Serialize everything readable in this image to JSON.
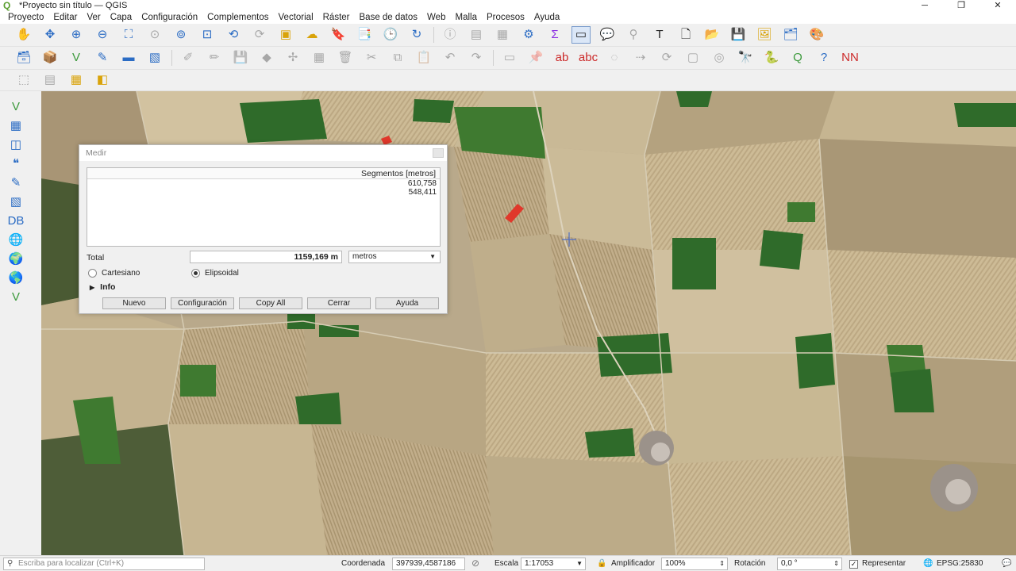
{
  "window": {
    "title": "*Proyecto sin título — QGIS",
    "controls": {
      "minimize": "─",
      "maximize": "❐",
      "close": "✕"
    }
  },
  "menubar": {
    "items": [
      "Proyecto",
      "Editar",
      "Ver",
      "Capa",
      "Configuración",
      "Complementos",
      "Vectorial",
      "Ráster",
      "Base de datos",
      "Web",
      "Malla",
      "Procesos",
      "Ayuda"
    ]
  },
  "colors": {
    "map_base": "#b9a98b",
    "field_green": "#2f6b2a",
    "measure_line": "#e0382b"
  },
  "icons": {
    "app": "qgis-logo-icon",
    "pan": "hand-icon",
    "zoom_in": "zoom-in-icon",
    "zoom_out": "zoom-out-icon",
    "identify": "identify-icon",
    "measure": "ruler-icon",
    "python": "python-icon",
    "help": "help-icon"
  },
  "measure_dialog": {
    "title": "Medir",
    "column_header": "Segmentos [metros]",
    "segments": [
      "610,758",
      "548,411"
    ],
    "total_label": "Total",
    "total_value": "1159,169 m",
    "units": "metros",
    "radio_cartesian": "Cartesiano",
    "radio_ellipsoidal": "Elipsoidal",
    "selected_mode": "Elipsoidal",
    "info_label": "Info",
    "buttons": {
      "new": "Nuevo",
      "config": "Configuración",
      "copy": "Copy All",
      "close": "Cerrar",
      "help": "Ayuda"
    }
  },
  "statusbar": {
    "locator_placeholder": "Escriba para localizar (Ctrl+K)",
    "coord_label": "Coordenada",
    "coord_value": "397939,4587186",
    "scale_label": "Escala",
    "scale_value": "1:17053",
    "magnifier_label": "Amplificador",
    "magnifier_value": "100%",
    "rotation_label": "Rotación",
    "rotation_value": "0,0 °",
    "render_label": "Representar",
    "render_checked": true,
    "crs": "EPSG:25830"
  }
}
